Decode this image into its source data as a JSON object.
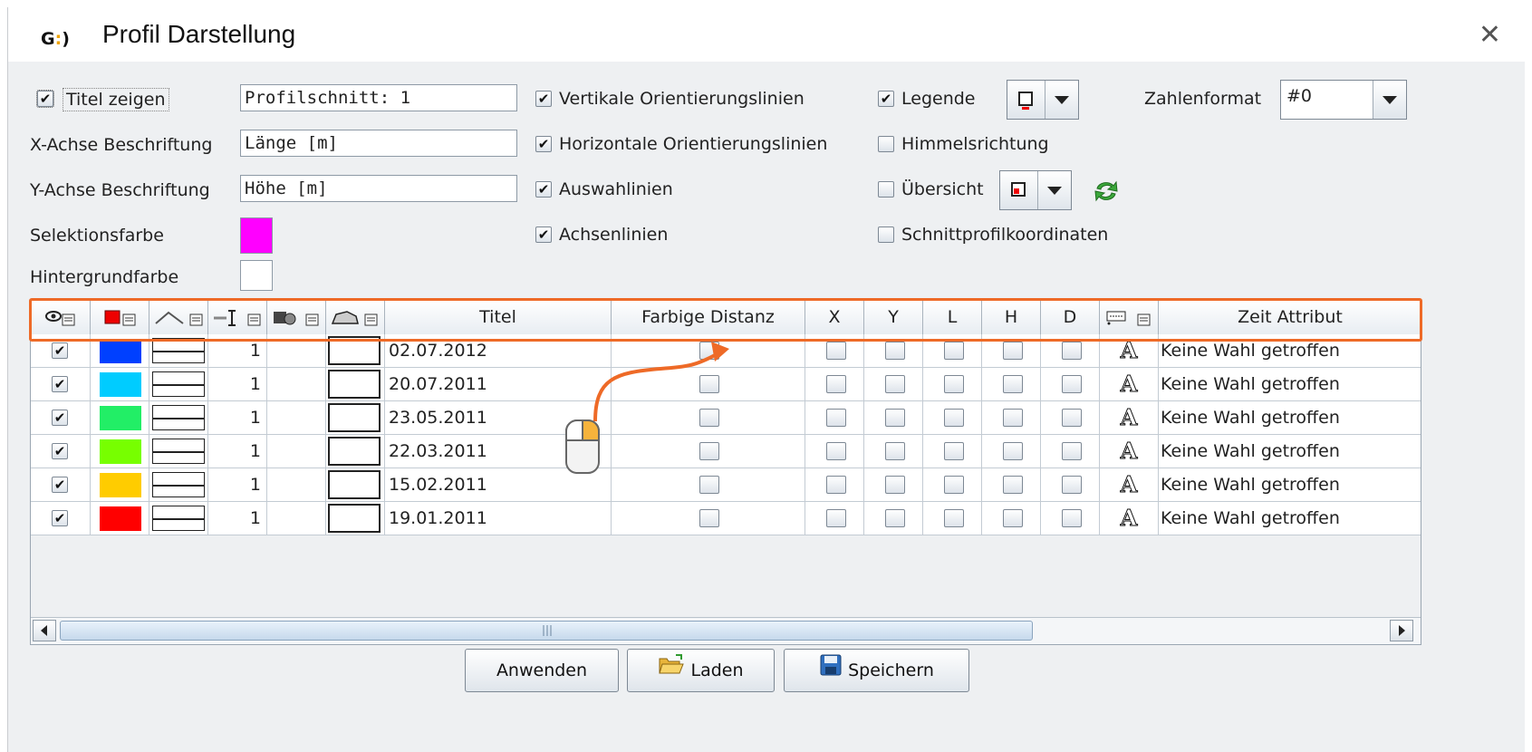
{
  "window": {
    "title": "Profil Darstellung",
    "logo_left": "G",
    "logo_right": ")",
    "close_glyph": "✕"
  },
  "options": {
    "titel_zeigen": {
      "label": "Titel zeigen",
      "checked": true,
      "value": "Profilschnitt: 1"
    },
    "x_achse": {
      "label": "X-Achse Beschriftung",
      "value": "Länge [m]"
    },
    "y_achse": {
      "label": "Y-Achse Beschriftung",
      "value": "Höhe [m]"
    },
    "selektionsfarbe": {
      "label": "Selektionsfarbe",
      "color": "#ff00ff"
    },
    "hintergrundfarbe": {
      "label": "Hintergrundfarbe",
      "color": "#ffffff"
    },
    "vertikale": {
      "label": "Vertikale Orientierungslinien",
      "checked": true
    },
    "horizontale": {
      "label": "Horizontale Orientierungslinien",
      "checked": true
    },
    "auswahllinien": {
      "label": "Auswahlinien",
      "checked": true
    },
    "achsenlinien": {
      "label": "Achsenlinien",
      "checked": true
    },
    "legende": {
      "label": "Legende",
      "checked": true
    },
    "himmelsrichtung": {
      "label": "Himmelsrichtung",
      "checked": false
    },
    "uebersicht": {
      "label": "Übersicht",
      "checked": false
    },
    "schnittprofil": {
      "label": "Schnittprofilkoordinaten",
      "checked": false
    },
    "zahlenformat": {
      "label": "Zahlenformat",
      "value": "#0"
    }
  },
  "table": {
    "headers": {
      "titel": "Titel",
      "farbige_distanz": "Farbige Distanz",
      "x": "X",
      "y": "Y",
      "l": "L",
      "h": "H",
      "d": "D",
      "zeit": "Zeit Attribut"
    },
    "rows": [
      {
        "visible": true,
        "color": "#0040ff",
        "width": "1",
        "titel": "02.07.2012",
        "zeit": "Keine Wahl getroffen"
      },
      {
        "visible": true,
        "color": "#00ccff",
        "width": "1",
        "titel": "20.07.2011",
        "zeit": "Keine Wahl getroffen"
      },
      {
        "visible": true,
        "color": "#22ee66",
        "width": "1",
        "titel": "23.05.2011",
        "zeit": "Keine Wahl getroffen"
      },
      {
        "visible": true,
        "color": "#77ff00",
        "width": "1",
        "titel": "22.03.2011",
        "zeit": "Keine Wahl getroffen"
      },
      {
        "visible": true,
        "color": "#ffcc00",
        "width": "1",
        "titel": "15.02.2011",
        "zeit": "Keine Wahl getroffen"
      },
      {
        "visible": true,
        "color": "#ff0000",
        "width": "1",
        "titel": "19.01.2011",
        "zeit": "Keine Wahl getroffen"
      }
    ]
  },
  "buttons": {
    "anwenden": "Anwenden",
    "laden": "Laden",
    "speichern": "Speichern"
  },
  "colors": {
    "highlight": "#ee6a27",
    "check": "✔"
  }
}
